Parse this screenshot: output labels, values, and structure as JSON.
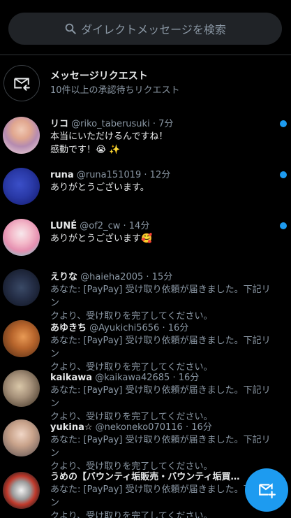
{
  "search": {
    "placeholder": "ダイレクトメッセージを検索"
  },
  "requests": {
    "title": "メッセージリクエスト",
    "subtitle": "10件以上の承認待ちリクエスト"
  },
  "conversations": [
    {
      "name": "リコ",
      "handle": "@riko_taberusuki",
      "time": "7分",
      "line1": "本当にいただけるんですね！",
      "line2": "感動です！😭 ✨",
      "unread": true
    },
    {
      "name": "runa",
      "handle": "@runa151019",
      "time": "12分",
      "line1": "ありがとうございます。",
      "line2": "",
      "unread": true
    },
    {
      "name": "LUNÉ",
      "handle": "@of2_cw",
      "time": "14分",
      "line1": "ありがとうございます🥰",
      "line2": "",
      "unread": true
    },
    {
      "name": "えりな",
      "handle": "@haieha2005",
      "time": "15分",
      "line1": "あなた: [PayPay] 受け取り依頼が届きました。下記リン",
      "line2": "クより、受け取りを完了してください。",
      "unread": false
    },
    {
      "name": "あゆきち",
      "handle": "@Ayukichi5656",
      "time": "16分",
      "line1": "あなた: [PayPay] 受け取り依頼が届きました。下記リン",
      "line2": "クより、受け取りを完了してください。",
      "unread": false
    },
    {
      "name": "kaikawa",
      "handle": "@kaikawa42685",
      "time": "16分",
      "line1": "あなた: [PayPay] 受け取り依頼が届きました。下記リン",
      "line2": "クより、受け取りを完了してください。",
      "unread": false
    },
    {
      "name": "yukina☆",
      "handle": "@nekoneko070116",
      "time": "16分",
      "line1": "あなた: [PayPay] 受け取り依頼が届きました。下記リン",
      "line2": "クより、受け取りを完了してください。",
      "unread": false
    },
    {
      "name": "うめの【バウンティ垢販売・バウンティ垢買…",
      "handle": "",
      "time": "",
      "line1": "あなた: [PayPay] 受け取り依頼が届きました。下記リン",
      "line2": "クより、受け取りを完了してください。",
      "unread": false
    }
  ],
  "colors": {
    "accent": "#1d9bf0",
    "background": "#000000",
    "secondary_text": "#8b98a5"
  },
  "icons": {
    "search": "search-icon",
    "requests": "envelope-arrow-icon",
    "compose": "new-message-icon"
  }
}
